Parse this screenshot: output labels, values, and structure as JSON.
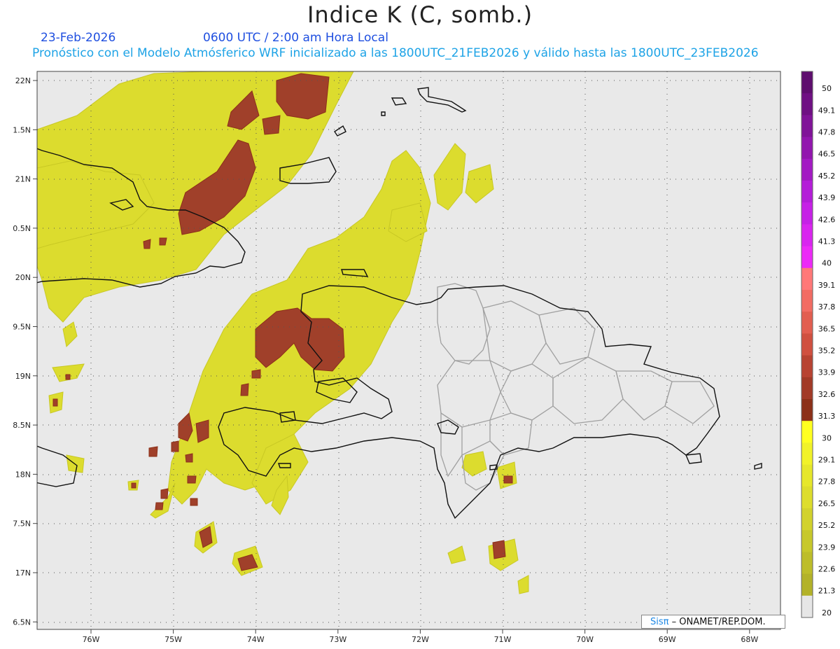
{
  "title": "Indice K (C, somb.)",
  "date": "23-Feb-2026",
  "time_label": "0600 UTC / 2:00 am Hora Local",
  "description": "Pronóstico con el Modelo Atmósferico WRF inicializado a las 1800UTC_21FEB2026 y válido hasta las  1800UTC_23FEB2026",
  "lat_labels": [
    "22N",
    "1.5N",
    "21N",
    "0.5N",
    "20N",
    "9.5N",
    "19N",
    "8.5N",
    "18N",
    "7.5N",
    "17N",
    "6.5N"
  ],
  "lon_labels": [
    "76W",
    "75W",
    "74W",
    "73W",
    "72W",
    "71W",
    "70W",
    "69W",
    "68W"
  ],
  "colorbar": {
    "levels": [
      "50",
      "49.1",
      "47.8",
      "46.5",
      "45.2",
      "43.9",
      "42.6",
      "41.3",
      "40",
      "39.1",
      "37.8",
      "36.5",
      "35.2",
      "33.9",
      "32.6",
      "31.3",
      "30",
      "29.1",
      "27.8",
      "26.5",
      "25.2",
      "23.9",
      "22.6",
      "21.3",
      "20"
    ],
    "colors": [
      "#5e0e6e",
      "#6f1083",
      "#801398",
      "#9216ae",
      "#a31ac3",
      "#b41dd8",
      "#c621e6",
      "#d925ef",
      "#ec2af7",
      "#ff7878",
      "#f26c63",
      "#e25e50",
      "#d05040",
      "#b84332",
      "#a23a27",
      "#8c3018",
      "#ffff20",
      "#f1f229",
      "#e6e72b",
      "#dddd2c",
      "#d2d22c",
      "#c7c82b",
      "#bdbd2a",
      "#b3b229",
      "#e6e6e6"
    ]
  },
  "credit": {
    "logo": "Sisπ",
    "text": "– ONAMET/REP.DOM."
  }
}
